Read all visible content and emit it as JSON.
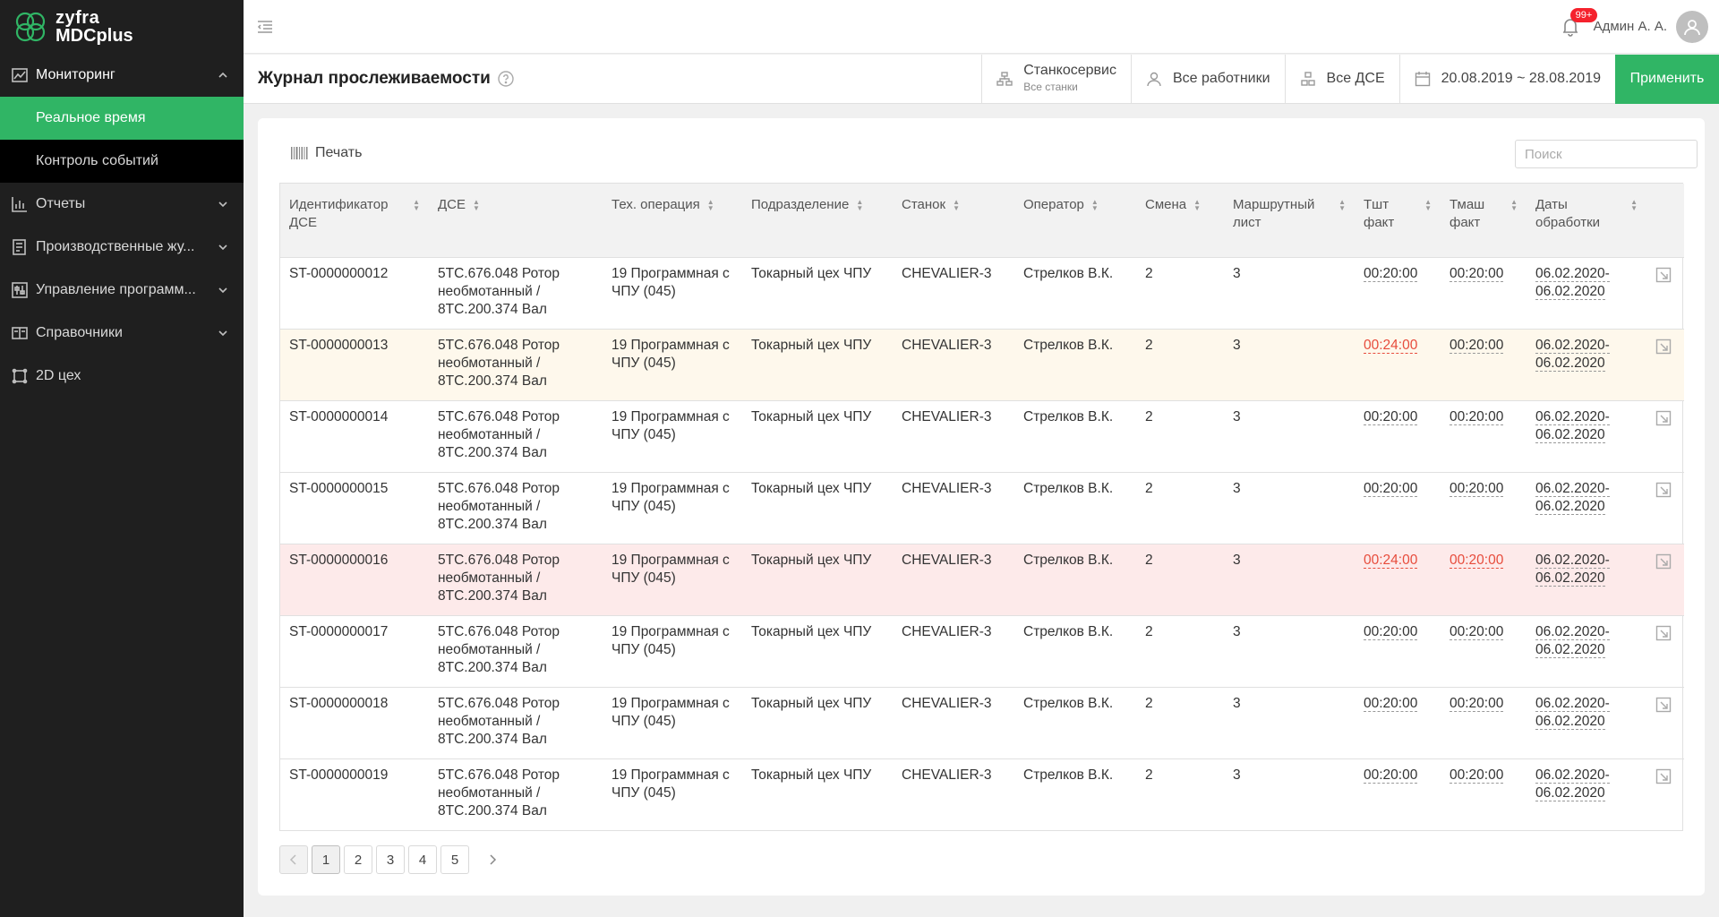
{
  "logo": {
    "line1": "zyfra",
    "line2": "MDCplus"
  },
  "sidebar": {
    "items": [
      {
        "label": "Мониторинг",
        "icon": "chart-line-icon",
        "open": true,
        "children": [
          {
            "label": "Реальное время",
            "active": true
          },
          {
            "label": "Контроль событий",
            "active": false
          }
        ]
      },
      {
        "label": "Отчеты",
        "icon": "bar-chart-icon"
      },
      {
        "label": "Производственные жу...",
        "icon": "journal-icon"
      },
      {
        "label": "Управление программ...",
        "icon": "sliders-icon"
      },
      {
        "label": "Справочники",
        "icon": "book-icon"
      },
      {
        "label": "2D цех",
        "icon": "floor-plan-icon"
      }
    ]
  },
  "topbar": {
    "notifications": "99+",
    "user": "Админ А. А."
  },
  "header": {
    "title": "Журнал прослеживаемости",
    "filters": {
      "machine": "Станкосервис",
      "machine_sub": "Все станки",
      "workers": "Все работники",
      "parts": "Все ДСЕ",
      "dates": "20.08.2019 ~ 28.08.2019"
    },
    "apply": "Применить"
  },
  "toolbar": {
    "print": "Печать",
    "search_placeholder": "Поиск"
  },
  "table": {
    "columns": [
      "Идентификатор ДСЕ",
      "ДСЕ",
      "Тех. операция",
      "Подразделение",
      "Станок",
      "Оператор",
      "Смена",
      "Маршрутный лист",
      "Тшт факт",
      "Тмаш факт",
      "Даты обработки"
    ],
    "rows": [
      {
        "id": "ST-0000000012",
        "part": "5ТС.676.048 Ротор необмотанный / 8ТС.200.374 Вал",
        "op": "19 Программная с ЧПУ (045)",
        "dept": "Токарный цех ЧПУ",
        "machine": "CHEVALIER-3",
        "operator": "Стрелков В.К.",
        "shift": "2",
        "route": "3",
        "tsht": "00:20:00",
        "tmash": "00:20:00",
        "date_from": "06.02.2020-",
        "date_to": "06.02.2020",
        "state": "normal",
        "tsht_red": false,
        "tmash_red": false
      },
      {
        "id": "ST-0000000013",
        "part": "5ТС.676.048 Ротор необмотанный / 8ТС.200.374 Вал",
        "op": "19 Программная с ЧПУ (045)",
        "dept": "Токарный цех ЧПУ",
        "machine": "CHEVALIER-3",
        "operator": "Стрелков В.К.",
        "shift": "2",
        "route": "3",
        "tsht": "00:24:00",
        "tmash": "00:20:00",
        "date_from": "06.02.2020-",
        "date_to": "06.02.2020",
        "state": "warn",
        "tsht_red": true,
        "tmash_red": false
      },
      {
        "id": "ST-0000000014",
        "part": "5ТС.676.048 Ротор необмотанный / 8ТС.200.374 Вал",
        "op": "19 Программная с ЧПУ (045)",
        "dept": "Токарный цех ЧПУ",
        "machine": "CHEVALIER-3",
        "operator": "Стрелков В.К.",
        "shift": "2",
        "route": "3",
        "tsht": "00:20:00",
        "tmash": "00:20:00",
        "date_from": "06.02.2020-",
        "date_to": "06.02.2020",
        "state": "normal",
        "tsht_red": false,
        "tmash_red": false
      },
      {
        "id": "ST-0000000015",
        "part": "5ТС.676.048 Ротор необмотанный / 8ТС.200.374 Вал",
        "op": "19 Программная с ЧПУ (045)",
        "dept": "Токарный цех ЧПУ",
        "machine": "CHEVALIER-3",
        "operator": "Стрелков В.К.",
        "shift": "2",
        "route": "3",
        "tsht": "00:20:00",
        "tmash": "00:20:00",
        "date_from": "06.02.2020-",
        "date_to": "06.02.2020",
        "state": "normal",
        "tsht_red": false,
        "tmash_red": false
      },
      {
        "id": "ST-0000000016",
        "part": "5ТС.676.048 Ротор необмотанный / 8ТС.200.374 Вал",
        "op": "19 Программная с ЧПУ (045)",
        "dept": "Токарный цех ЧПУ",
        "machine": "CHEVALIER-3",
        "operator": "Стрелков В.К.",
        "shift": "2",
        "route": "3",
        "tsht": "00:24:00",
        "tmash": "00:20:00",
        "date_from": "06.02.2020-",
        "date_to": "06.02.2020",
        "state": "error",
        "tsht_red": true,
        "tmash_red": true
      },
      {
        "id": "ST-0000000017",
        "part": "5ТС.676.048 Ротор необмотанный / 8ТС.200.374 Вал",
        "op": "19 Программная с ЧПУ (045)",
        "dept": "Токарный цех ЧПУ",
        "machine": "CHEVALIER-3",
        "operator": "Стрелков В.К.",
        "shift": "2",
        "route": "3",
        "tsht": "00:20:00",
        "tmash": "00:20:00",
        "date_from": "06.02.2020-",
        "date_to": "06.02.2020",
        "state": "normal",
        "tsht_red": false,
        "tmash_red": false
      },
      {
        "id": "ST-0000000018",
        "part": "5ТС.676.048 Ротор необмотанный / 8ТС.200.374 Вал",
        "op": "19 Программная с ЧПУ (045)",
        "dept": "Токарный цех ЧПУ",
        "machine": "CHEVALIER-3",
        "operator": "Стрелков В.К.",
        "shift": "2",
        "route": "3",
        "tsht": "00:20:00",
        "tmash": "00:20:00",
        "date_from": "06.02.2020-",
        "date_to": "06.02.2020",
        "state": "normal",
        "tsht_red": false,
        "tmash_red": false
      },
      {
        "id": "ST-0000000019",
        "part": "5ТС.676.048 Ротор необмотанный / 8ТС.200.374 Вал",
        "op": "19 Программная с ЧПУ (045)",
        "dept": "Токарный цех ЧПУ",
        "machine": "CHEVALIER-3",
        "operator": "Стрелков В.К.",
        "shift": "2",
        "route": "3",
        "tsht": "00:20:00",
        "tmash": "00:20:00",
        "date_from": "06.02.2020-",
        "date_to": "06.02.2020",
        "state": "normal",
        "tsht_red": false,
        "tmash_red": false
      }
    ]
  },
  "pagination": {
    "pages": [
      "1",
      "2",
      "3",
      "4",
      "5"
    ],
    "current": "1"
  },
  "colors": {
    "accent": "#30b565",
    "sidebar": "#1f1f1f",
    "warn_row": "#fef8ec",
    "error_row": "#fdeaea",
    "error_text": "#e74c3c",
    "badge": "#f5222d"
  }
}
